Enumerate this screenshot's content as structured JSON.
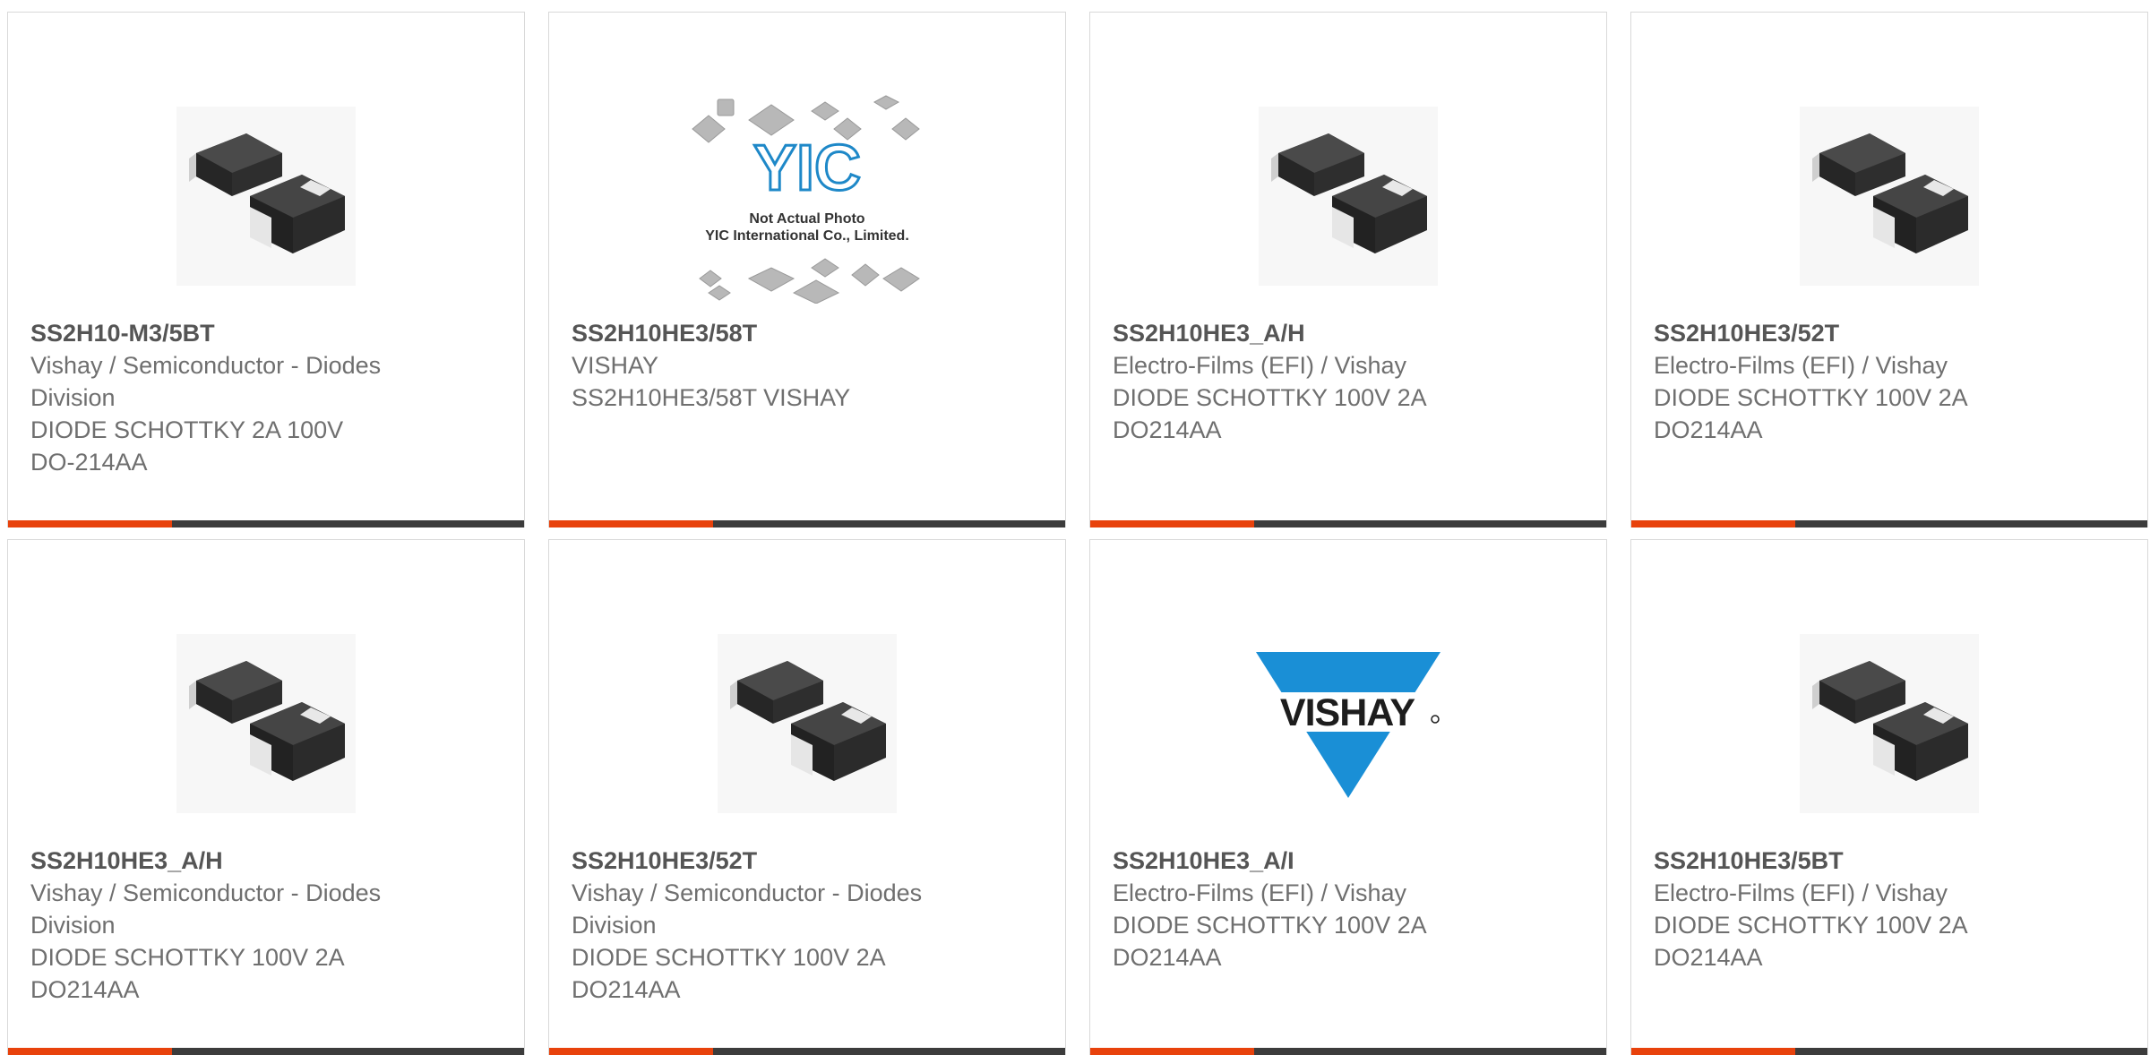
{
  "accent_color": "#e8420c",
  "cards": [
    {
      "part": "SS2H10-M3/5BT",
      "lines": [
        "Vishay / Semiconductor - Diodes",
        "Division",
        "DIODE SCHOTTKY 2A 100V",
        "DO-214AA"
      ],
      "image": "smd-diode-photo"
    },
    {
      "part": "SS2H10HE3/58T",
      "lines": [
        "VISHAY",
        "SS2H10HE3/58T VISHAY",
        "",
        ""
      ],
      "image": "yic-placeholder",
      "img_text": {
        "brand": "YIC",
        "note1": "Not Actual Photo",
        "note2": "YIC International Co., Limited."
      }
    },
    {
      "part": "SS2H10HE3_A/H",
      "lines": [
        "Electro-Films (EFI) / Vishay",
        "DIODE SCHOTTKY 100V 2A",
        "DO214AA",
        ""
      ],
      "image": "smd-diode-photo"
    },
    {
      "part": "SS2H10HE3/52T",
      "lines": [
        "Electro-Films (EFI) / Vishay",
        "DIODE SCHOTTKY 100V 2A",
        "DO214AA",
        ""
      ],
      "image": "smd-diode-photo"
    },
    {
      "part": "SS2H10HE3_A/H",
      "lines": [
        "Vishay / Semiconductor - Diodes",
        "Division",
        "DIODE SCHOTTKY 100V 2A",
        "DO214AA"
      ],
      "image": "smd-diode-photo"
    },
    {
      "part": "SS2H10HE3/52T",
      "lines": [
        "Vishay / Semiconductor - Diodes",
        "Division",
        "DIODE SCHOTTKY 100V 2A",
        "DO214AA"
      ],
      "image": "smd-diode-photo"
    },
    {
      "part": "SS2H10HE3_A/I",
      "lines": [
        "Electro-Films (EFI) / Vishay",
        "DIODE SCHOTTKY 100V 2A",
        "DO214AA",
        ""
      ],
      "image": "vishay-logo"
    },
    {
      "part": "SS2H10HE3/5BT",
      "lines": [
        "Electro-Films (EFI) / Vishay",
        "DIODE SCHOTTKY 100V 2A",
        "DO214AA",
        ""
      ],
      "image": "smd-diode-photo"
    }
  ]
}
